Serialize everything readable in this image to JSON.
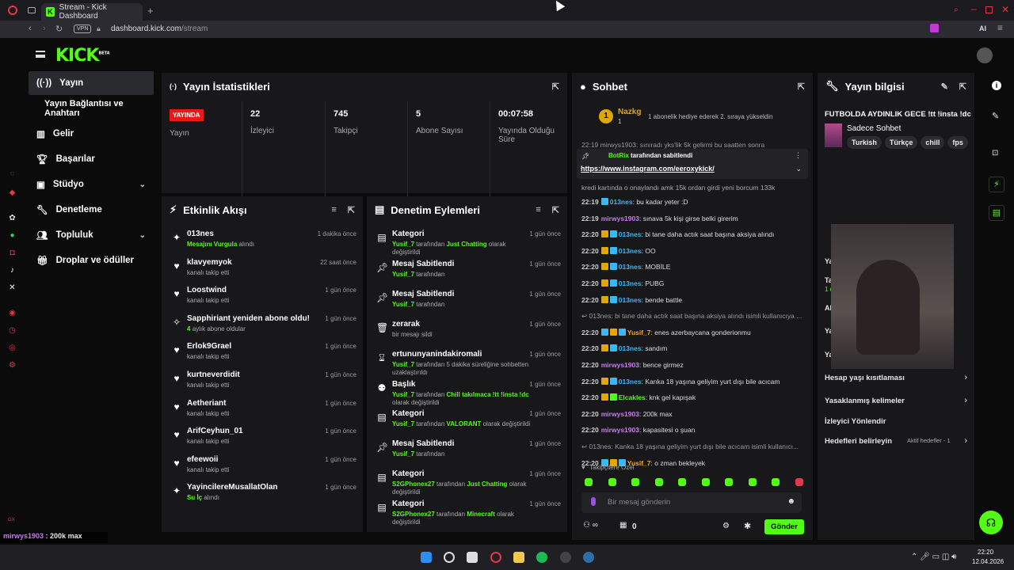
{
  "browser": {
    "tab_title": "Stream - Kick Dashboard",
    "vpn": "VPN",
    "url_host": "dashboard.kick.com",
    "url_path": "/stream",
    "ai_label": "AI"
  },
  "logo": {
    "text": "KICK",
    "beta": "BETA"
  },
  "nav": {
    "items": [
      {
        "label": "Yayın",
        "icon": "broadcast-icon"
      },
      {
        "label": "Yayın Bağlantısı ve Anahtarı",
        "icon": ""
      },
      {
        "label": "Gelir",
        "icon": "chart-icon"
      },
      {
        "label": "Başarılar",
        "icon": "trophy-icon"
      },
      {
        "label": "Stüdyo",
        "icon": "studio-icon"
      },
      {
        "label": "Denetleme",
        "icon": "wrench-icon"
      },
      {
        "label": "Topluluk",
        "icon": "people-icon"
      },
      {
        "label": "Droplar ve ödüller",
        "icon": "gift-icon"
      }
    ]
  },
  "stats": {
    "title": "Yayın İstatistikleri",
    "items": [
      {
        "value": "YAYINDA",
        "label": "Yayın"
      },
      {
        "value": "22",
        "label": "İzleyici"
      },
      {
        "value": "745",
        "label": "Takipçi"
      },
      {
        "value": "5",
        "label": "Abone Sayısı"
      },
      {
        "value": "00:07:58",
        "label": "Yayında Olduğu Süre"
      }
    ]
  },
  "activity": {
    "title": "Etkinlik Akışı",
    "rows": [
      {
        "name": "013nes",
        "text": "Mesajını Vurgula",
        "text2": "alındı",
        "time": "1 dakika önce",
        "icon": "sparkle-icon"
      },
      {
        "name": "klavyemyok",
        "text": "",
        "text2": "kanalı takip etti",
        "time": "22 saat önce",
        "icon": "heart-icon"
      },
      {
        "name": "Loostwind",
        "text": "",
        "text2": "kanalı takip etti",
        "time": "1 gün önce",
        "icon": "heart-icon"
      },
      {
        "name": "Sapphiriant yeniden abone oldu!",
        "text": "4",
        "text2": "aylık abone oldular",
        "time": "1 gün önce",
        "icon": "star-icon"
      },
      {
        "name": "Erlok9Grael",
        "text": "",
        "text2": "kanalı takip etti",
        "time": "1 gün önce",
        "icon": "heart-icon"
      },
      {
        "name": "kurtneverdidit",
        "text": "",
        "text2": "kanalı takip etti",
        "time": "1 gün önce",
        "icon": "heart-icon"
      },
      {
        "name": "Aetheriant",
        "text": "",
        "text2": "kanalı takip etti",
        "time": "1 gün önce",
        "icon": "heart-icon"
      },
      {
        "name": "ArifCeyhun_01",
        "text": "",
        "text2": "kanalı takip etti",
        "time": "1 gün önce",
        "icon": "heart-icon"
      },
      {
        "name": "efeewoii",
        "text": "",
        "text2": "kanalı takip etti",
        "time": "1 gün önce",
        "icon": "heart-icon"
      },
      {
        "name": "YayincilereMusallatOlan",
        "text": "Su İç",
        "text2": "alındı",
        "time": "1 gün önce",
        "icon": "sparkle-icon"
      }
    ]
  },
  "moderation": {
    "title": "Denetim Eylemleri",
    "rows": [
      {
        "name": "Kategori",
        "user": "Yusif_7",
        "mid": "tarafından",
        "val": "Just Chatting",
        "tail": "olarak değiştirildi",
        "time": "1 gün önce",
        "icon": "category-icon"
      },
      {
        "name": "Mesaj Sabitlendi",
        "user": "Yusif_7",
        "mid": "tarafından",
        "val": "",
        "tail": "",
        "time": "1 gün önce",
        "icon": "pin-icon"
      },
      {
        "name": "Mesaj Sabitlendi",
        "user": "Yusif_7",
        "mid": "tarafından",
        "val": "",
        "tail": "",
        "time": "1 gün önce",
        "icon": "pin-icon"
      },
      {
        "name": "zerarak",
        "user": "",
        "mid": "bir mesajı sildi",
        "val": "",
        "tail": "",
        "time": "1 gün önce",
        "icon": "trash-icon"
      },
      {
        "name": "ertununyanindakiromali",
        "user": "Yusif_7",
        "mid": "tarafından 5 dakika süreliğine sohbetten uzaklaştırıldı",
        "val": "",
        "tail": "",
        "time": "1 gün önce",
        "icon": "hourglass-icon"
      },
      {
        "name": "Başlık",
        "user": "Yusif_7",
        "mid": "tarafından",
        "val": "Chill takılmaca !tt !insta !dc",
        "tail": "olarak değiştirildi",
        "time": "1 gün önce",
        "icon": "title-icon"
      },
      {
        "name": "Kategori",
        "user": "Yusif_7",
        "mid": "tarafından",
        "val": "VALORANT",
        "tail": "olarak değiştirildi",
        "time": "1 gün önce",
        "icon": "category-icon"
      },
      {
        "name": "Mesaj Sabitlendi",
        "user": "Yusif_7",
        "mid": "tarafından",
        "val": "",
        "tail": "",
        "time": "1 gün önce",
        "icon": "pin-icon"
      },
      {
        "name": "Kategori",
        "user": "S2GPhonex27",
        "mid": "tarafından",
        "val": "Just Chatting",
        "tail": "olarak değiştirildi",
        "time": "1 gün önce",
        "icon": "category-icon"
      },
      {
        "name": "Kategori",
        "user": "S2GPhonex27",
        "mid": "tarafından",
        "val": "Minecraft",
        "tail": "olarak değiştirildi",
        "time": "1 gün önce",
        "icon": "category-icon"
      }
    ]
  },
  "chat": {
    "title": "Sohbet",
    "gift": {
      "user": "Nazkg",
      "rank": "1",
      "count": "1",
      "text": "1 abonelik hediye ederek 2. sıraya yükseldin"
    },
    "partial_top": "22:19 mirwys1903: sınıradı yks'lik 5k gelirmi bu saatten sonra",
    "pinned": {
      "by": "BotRix",
      "by_text": "tarafından sabitlendi",
      "link": "https://www.instagram.com/eeroxykick/"
    },
    "partial_after": "kredi kartında o onaylandı amk 15k ordan girdi yeni borcum 133k",
    "lines": [
      {
        "time": "22:19",
        "user": "013nes",
        "color": "#3ab7f5",
        "msg": "bu kadar yeter :D",
        "badges": [
          "#3ab7f5"
        ]
      },
      {
        "time": "22:19",
        "user": "mirwys1903",
        "color": "#c97cf0",
        "msg": "sınava 5k kişi girse belki girerim",
        "badges": []
      },
      {
        "time": "22:20",
        "user": "013nes",
        "color": "#3ab7f5",
        "msg": "bi tane daha actık saat başına aksiya alındı",
        "badges": [
          "#e0a800",
          "#3ab7f5"
        ]
      },
      {
        "time": "22:20",
        "user": "013nes",
        "color": "#3ab7f5",
        "msg": "OO",
        "badges": [
          "#e0a800",
          "#3ab7f5"
        ]
      },
      {
        "time": "22:20",
        "user": "013nes",
        "color": "#3ab7f5",
        "msg": "MOBİLE",
        "badges": [
          "#e0a800",
          "#3ab7f5"
        ]
      },
      {
        "time": "22:20",
        "user": "013nes",
        "color": "#3ab7f5",
        "msg": "PUBG",
        "badges": [
          "#e0a800",
          "#3ab7f5"
        ]
      },
      {
        "time": "22:20",
        "user": "013nes",
        "color": "#3ab7f5",
        "msg": "bende battle",
        "badges": [
          "#e0a800",
          "#3ab7f5"
        ]
      },
      {
        "time": "",
        "user": "",
        "color": "#999",
        "msg": "013nes: bi tane daha actık saat başına aksiya alındı isimli kullanıcıya ...",
        "badges": [],
        "reply": true
      },
      {
        "time": "22:20",
        "user": "Yusif_7",
        "color": "#f5a623",
        "msg": "enes azerbaycana gonderionmu",
        "badges": [
          "#3ab7f5",
          "#e0a800",
          "#3ab7f5"
        ]
      },
      {
        "time": "22:20",
        "user": "013nes",
        "color": "#3ab7f5",
        "msg": "sandım",
        "badges": [
          "#e0a800",
          "#3ab7f5"
        ]
      },
      {
        "time": "22:20",
        "user": "mirwys1903",
        "color": "#c97cf0",
        "msg": "bence girmez",
        "badges": []
      },
      {
        "time": "22:20",
        "user": "013nes",
        "color": "#3ab7f5",
        "msg": "Kanka 18 yaşına geliyim yurt dışı bile acıcam",
        "badges": [
          "#e0a800",
          "#3ab7f5"
        ]
      },
      {
        "time": "22:20",
        "user": "Elcakles",
        "color": "#53fc18",
        "msg": "knk gel kapışak",
        "badges": [
          "#e0a800",
          "#53fc18"
        ]
      },
      {
        "time": "22:20",
        "user": "mirwys1903",
        "color": "#c97cf0",
        "msg": "200k max",
        "badges": []
      },
      {
        "time": "22:20",
        "user": "mirwys1903",
        "color": "#c97cf0",
        "msg": "kapasitesi o şuan",
        "badges": []
      },
      {
        "time": "",
        "user": "",
        "color": "#999",
        "msg": "013nes: Kanka 18 yaşına geliyim yurt dışı bile acıcam isimli kullanıcı...",
        "badges": [],
        "reply": true
      },
      {
        "time": "22:20",
        "user": "Yusif_7",
        "color": "#f5a623",
        "msg": "o zman bekleyek",
        "badges": [
          "#3ab7f5",
          "#e0a800",
          "#3ab7f5"
        ]
      }
    ],
    "emote_label": "Takipçilere Özel",
    "input_placeholder": "Bir mesaj gönderin",
    "points": "0",
    "send": "Gönder"
  },
  "info": {
    "title": "Yayın bilgisi",
    "stream_title": "FUTBOLDA AYDINLIK GECE !tt !insta !dc",
    "category": "Sadece Sohbet",
    "tags": [
      "Turkish",
      "Türkçe",
      "chill",
      "fps"
    ],
    "settings": [
      {
        "label": "Hesap yaşı kısıtlaması",
        "extra": ""
      },
      {
        "label": "Yasaklanmış kelimeler",
        "extra": ""
      },
      {
        "label": "İzleyici Yönlendir",
        "extra": ""
      },
      {
        "label": "Hedefleri belirleyin",
        "extra": "Aktif hedefler - 1"
      }
    ],
    "hidden_labels": [
      "Ya",
      "Ta",
      "1 d",
      "Al",
      "Ya",
      "Ya"
    ]
  },
  "overlay": {
    "lines": [
      {
        "user": "mirwys1903",
        "msg": "200k max"
      },
      {
        "user": "mirwys1903",
        "msg": "kapasitesi o şuan"
      },
      {
        "user": "Yusif_7",
        "msg": "o zman bekleyek"
      }
    ]
  },
  "taskbar": {
    "time": "22:20",
    "date": "12.04.2026"
  },
  "colors": {
    "accent": "#53fc18",
    "live": "#e91916",
    "panel": "#18181b",
    "bg": "#0b0b0c"
  }
}
